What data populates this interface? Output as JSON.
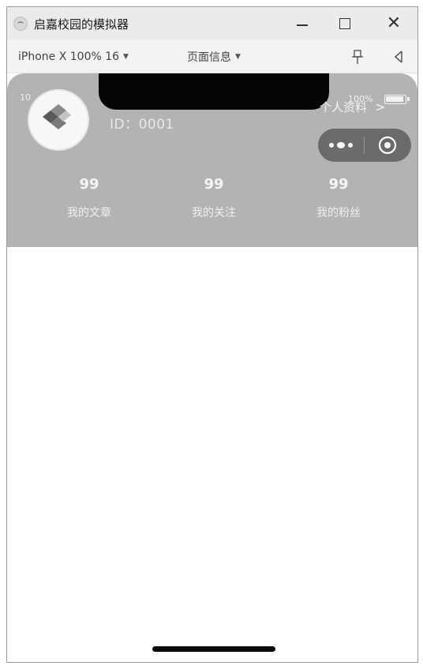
{
  "window": {
    "title": "启嘉校园的模拟器"
  },
  "toolbar": {
    "device": "iPhone X 100% 16",
    "page_info": "页面信息"
  },
  "status_bar": {
    "time": "10",
    "battery": "100%"
  },
  "profile": {
    "id_text": "ID：0001",
    "profile_link": "个人资料"
  },
  "stats": [
    {
      "value": "99",
      "label": "我的文章"
    },
    {
      "value": "99",
      "label": "我的关注"
    },
    {
      "value": "99",
      "label": "我的粉丝"
    }
  ],
  "icons": {
    "app": "app-icon",
    "pin": "pin-icon",
    "volume": "volume-icon",
    "more": "more-dots-icon",
    "target": "target-icon",
    "logo": "logo-icon"
  }
}
